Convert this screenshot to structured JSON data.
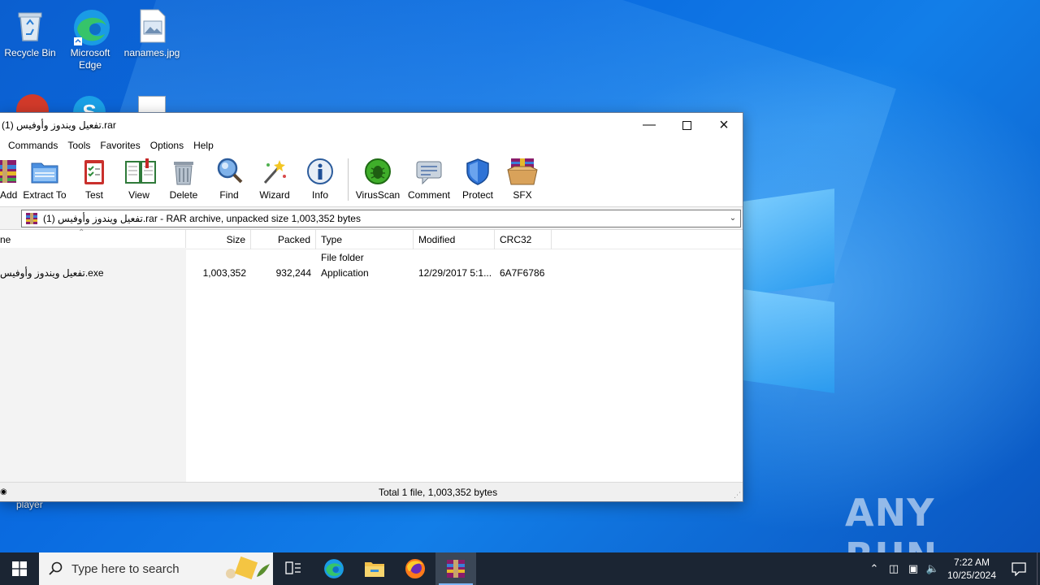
{
  "desktop": {
    "icons": [
      {
        "label": "Recycle Bin"
      },
      {
        "label": "Microsoft Edge"
      },
      {
        "label": "nanames.jpg"
      }
    ],
    "player_label": "player",
    "watermark": "ANY RUN"
  },
  "window": {
    "title": "تفعيل ويندوز وأوفيس (1).rar",
    "menu": [
      "Commands",
      "Tools",
      "Favorites",
      "Options",
      "Help"
    ],
    "toolbar": [
      {
        "label": "Add",
        "icon": "add-archive-icon"
      },
      {
        "label": "Extract To",
        "icon": "extract-folder-icon"
      },
      {
        "label": "Test",
        "icon": "test-clipboard-icon"
      },
      {
        "label": "View",
        "icon": "book-icon"
      },
      {
        "label": "Delete",
        "icon": "trash-icon"
      },
      {
        "label": "Find",
        "icon": "magnifier-icon"
      },
      {
        "label": "Wizard",
        "icon": "wand-icon"
      },
      {
        "label": "Info",
        "icon": "info-icon"
      },
      {
        "label": "VirusScan",
        "icon": "bug-scan-icon"
      },
      {
        "label": "Comment",
        "icon": "comment-icon"
      },
      {
        "label": "Protect",
        "icon": "shield-icon"
      },
      {
        "label": "SFX",
        "icon": "sfx-box-icon"
      }
    ],
    "address": "تفعيل ويندوز وأوفيس (1).rar - RAR archive, unpacked size 1,003,352 bytes",
    "columns": {
      "name": "ne",
      "size": "Size",
      "packed": "Packed",
      "type": "Type",
      "modified": "Modified",
      "crc": "CRC32"
    },
    "rows": [
      {
        "name": "",
        "size": "",
        "packed": "",
        "type": "File folder",
        "modified": "",
        "crc": ""
      },
      {
        "name": "تفعيل ويندوز وأوفيس.exe",
        "size": "1,003,352",
        "packed": "932,244",
        "type": "Application",
        "modified": "12/29/2017 5:1...",
        "crc": "6A7F6786"
      }
    ],
    "status": "Total 1 file, 1,003,352 bytes"
  },
  "taskbar": {
    "search_placeholder": "Type here to search",
    "time": "7:22 AM",
    "date": "10/25/2024"
  }
}
